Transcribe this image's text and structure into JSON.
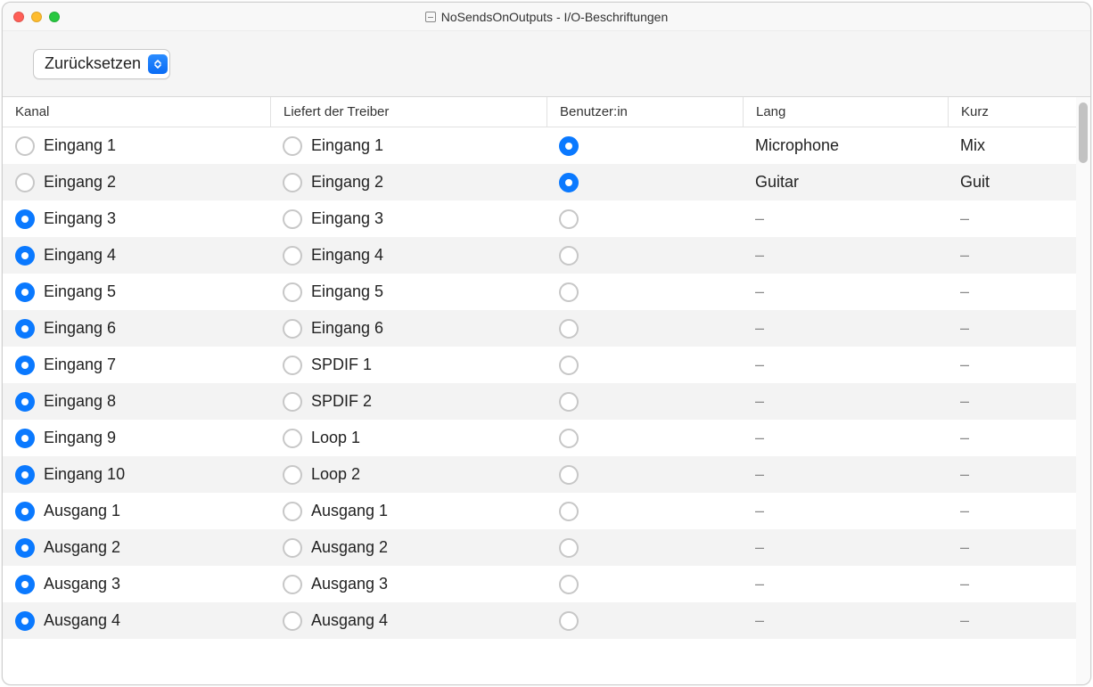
{
  "window": {
    "title": "NoSendsOnOutputs - I/O-Beschriftungen"
  },
  "toolbar": {
    "reset_label": "Zurücksetzen"
  },
  "columns": {
    "kanal": "Kanal",
    "treiber": "Liefert der Treiber",
    "benutzer": "Benutzer:in",
    "lang": "Lang",
    "kurz": "Kurz"
  },
  "rows": [
    {
      "kanal": "Eingang 1",
      "kanal_sel": false,
      "treiber": "Eingang 1",
      "treiber_sel": false,
      "benutzer_sel": true,
      "lang": "Microphone",
      "kurz": "Mix"
    },
    {
      "kanal": "Eingang 2",
      "kanal_sel": false,
      "treiber": "Eingang 2",
      "treiber_sel": false,
      "benutzer_sel": true,
      "lang": "Guitar",
      "kurz": "Guit"
    },
    {
      "kanal": "Eingang 3",
      "kanal_sel": true,
      "treiber": "Eingang 3",
      "treiber_sel": false,
      "benutzer_sel": false,
      "lang": "–",
      "kurz": "–"
    },
    {
      "kanal": "Eingang 4",
      "kanal_sel": true,
      "treiber": "Eingang 4",
      "treiber_sel": false,
      "benutzer_sel": false,
      "lang": "–",
      "kurz": "–"
    },
    {
      "kanal": "Eingang 5",
      "kanal_sel": true,
      "treiber": "Eingang 5",
      "treiber_sel": false,
      "benutzer_sel": false,
      "lang": "–",
      "kurz": "–"
    },
    {
      "kanal": "Eingang 6",
      "kanal_sel": true,
      "treiber": "Eingang 6",
      "treiber_sel": false,
      "benutzer_sel": false,
      "lang": "–",
      "kurz": "–"
    },
    {
      "kanal": "Eingang 7",
      "kanal_sel": true,
      "treiber": "SPDIF 1",
      "treiber_sel": false,
      "benutzer_sel": false,
      "lang": "–",
      "kurz": "–"
    },
    {
      "kanal": "Eingang 8",
      "kanal_sel": true,
      "treiber": "SPDIF 2",
      "treiber_sel": false,
      "benutzer_sel": false,
      "lang": "–",
      "kurz": "–"
    },
    {
      "kanal": "Eingang 9",
      "kanal_sel": true,
      "treiber": "Loop 1",
      "treiber_sel": false,
      "benutzer_sel": false,
      "lang": "–",
      "kurz": "–"
    },
    {
      "kanal": "Eingang 10",
      "kanal_sel": true,
      "treiber": "Loop 2",
      "treiber_sel": false,
      "benutzer_sel": false,
      "lang": "–",
      "kurz": "–"
    },
    {
      "kanal": "Ausgang 1",
      "kanal_sel": true,
      "treiber": "Ausgang 1",
      "treiber_sel": false,
      "benutzer_sel": false,
      "lang": "–",
      "kurz": "–"
    },
    {
      "kanal": "Ausgang 2",
      "kanal_sel": true,
      "treiber": "Ausgang 2",
      "treiber_sel": false,
      "benutzer_sel": false,
      "lang": "–",
      "kurz": "–"
    },
    {
      "kanal": "Ausgang 3",
      "kanal_sel": true,
      "treiber": "Ausgang 3",
      "treiber_sel": false,
      "benutzer_sel": false,
      "lang": "–",
      "kurz": "–"
    },
    {
      "kanal": "Ausgang 4",
      "kanal_sel": true,
      "treiber": "Ausgang 4",
      "treiber_sel": false,
      "benutzer_sel": false,
      "lang": "–",
      "kurz": "–"
    }
  ]
}
